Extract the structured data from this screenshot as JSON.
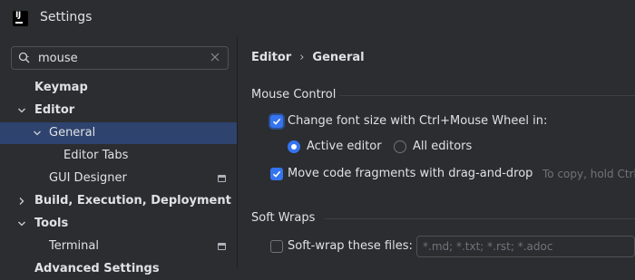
{
  "window": {
    "title": "Settings",
    "logo_text": "IJ"
  },
  "search": {
    "value": "mouse"
  },
  "tree": [
    {
      "label": "Keymap",
      "bold": true
    },
    {
      "label": "Editor",
      "bold": true,
      "expanded": true
    },
    {
      "label": "General",
      "bold": false,
      "expanded": true,
      "selected": true
    },
    {
      "label": "Editor Tabs",
      "bold": false
    },
    {
      "label": "GUI Designer",
      "bold": false,
      "badge": "project-scope-icon"
    },
    {
      "label": "Build, Execution, Deployment",
      "bold": true,
      "expanded": false
    },
    {
      "label": "Tools",
      "bold": true,
      "expanded": true
    },
    {
      "label": "Terminal",
      "bold": false,
      "badge": "project-scope-icon"
    },
    {
      "label": "Advanced Settings",
      "bold": true
    }
  ],
  "breadcrumb": {
    "parent": "Editor",
    "separator": "›",
    "current": "General"
  },
  "mouse_control": {
    "title": "Mouse Control",
    "change_font_size": {
      "label": "Change font size with Ctrl+Mouse Wheel in:",
      "checked": true
    },
    "active_editor": {
      "label": "Active editor",
      "selected": true
    },
    "all_editors": {
      "label": "All editors",
      "selected": false
    },
    "move_code": {
      "label": "Move code fragments with drag-and-drop",
      "checked": true
    },
    "move_code_hint": "To copy, hold Ctrl"
  },
  "soft_wraps": {
    "title": "Soft Wraps",
    "soft_wrap_files": {
      "label": "Soft-wrap these files:",
      "checked": false
    },
    "files_placeholder": "*.md; *.txt; *.rst; *.adoc"
  },
  "colors": {
    "accent": "#3574f0",
    "selection": "#2e436e",
    "background": "#2b2d30"
  }
}
